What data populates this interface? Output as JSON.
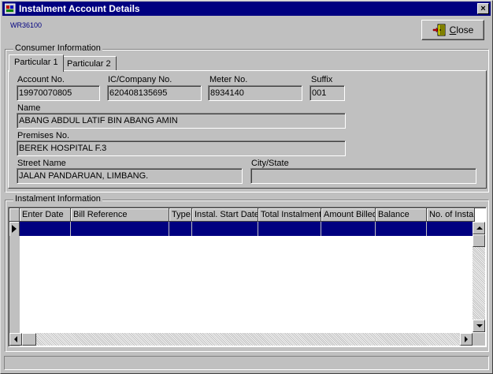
{
  "window": {
    "title": "Instalment Account Details",
    "close_glyph": "×",
    "icon": "app-icon"
  },
  "form_code": "WR36100",
  "toolbar": {
    "close_label": "Close",
    "close_icon": "door-exit-icon"
  },
  "consumer": {
    "group_title": "Consumer Information",
    "tabs": [
      {
        "label": "Particular 1",
        "active": true
      },
      {
        "label": "Particular 2",
        "active": false
      }
    ],
    "fields": {
      "account_no": {
        "label": "Account No.",
        "value": "19970070805"
      },
      "ic_company_no": {
        "label": "IC/Company No.",
        "value": "620408135695"
      },
      "meter_no": {
        "label": "Meter No.",
        "value": "8934140"
      },
      "suffix": {
        "label": "Suffix",
        "value": "001"
      },
      "name": {
        "label": "Name",
        "value": "ABANG ABDUL LATIF BIN ABANG AMIN"
      },
      "premises_no": {
        "label": "Premises No.",
        "value": "BEREK HOSPITAL F.3"
      },
      "street_name": {
        "label": "Street Name",
        "value": "JALAN PANDARUAN, LIMBANG."
      },
      "city_state": {
        "label": "City/State",
        "value": ""
      }
    }
  },
  "instalment": {
    "group_title": "Instalment Information",
    "columns": [
      "Enter Date",
      "Bill Reference",
      "Type",
      "Instal. Start Date",
      "Total Instalment",
      "Amount Billed",
      "Balance",
      "No. of Instalment"
    ],
    "rows": [],
    "selected_row_color": "#000080"
  },
  "colors": {
    "title_bar": "#000080",
    "face": "#c0c0c0",
    "form_code": "#000080"
  }
}
